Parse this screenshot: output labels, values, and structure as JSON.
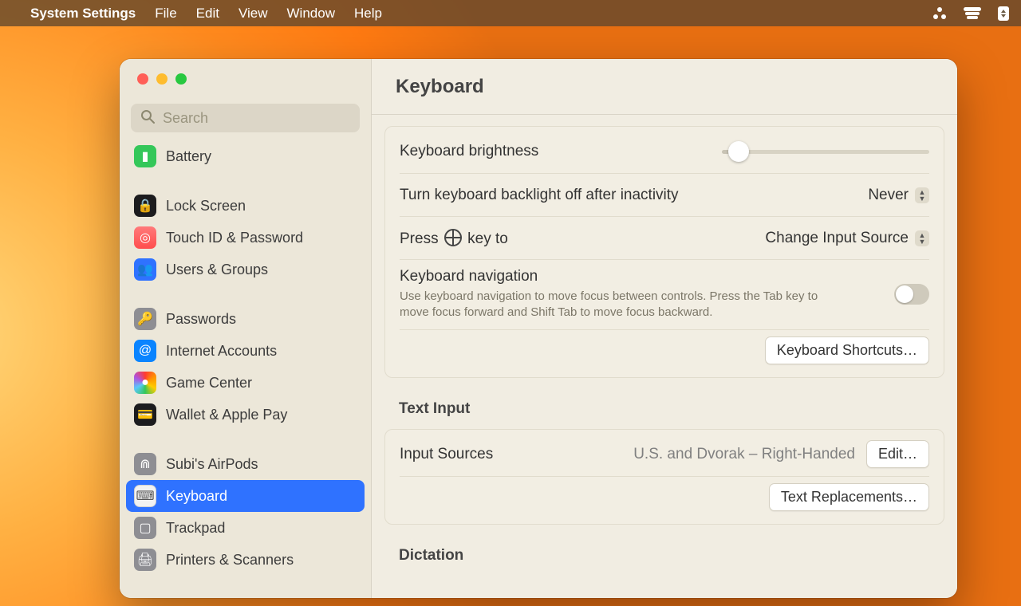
{
  "menubar": {
    "app": "System Settings",
    "items": [
      "File",
      "Edit",
      "View",
      "Window",
      "Help"
    ]
  },
  "search": {
    "placeholder": "Search"
  },
  "sidebar": {
    "items": [
      {
        "label": "Battery",
        "icon": "battery-icon",
        "cls": "bg-green"
      },
      {
        "spacer": true
      },
      {
        "label": "Lock Screen",
        "icon": "lock-icon",
        "cls": "bg-black"
      },
      {
        "label": "Touch ID & Password",
        "icon": "fingerprint-icon",
        "cls": "bg-pinkgr"
      },
      {
        "label": "Users & Groups",
        "icon": "users-icon",
        "cls": "bg-blue"
      },
      {
        "spacer": true
      },
      {
        "label": "Passwords",
        "icon": "key-icon",
        "cls": "bg-grey"
      },
      {
        "label": "Internet Accounts",
        "icon": "at-icon",
        "cls": "bg-blue2"
      },
      {
        "label": "Game Center",
        "icon": "gamecenter-icon",
        "cls": "bg-rainbow"
      },
      {
        "label": "Wallet & Apple Pay",
        "icon": "wallet-icon",
        "cls": "bg-wallet"
      },
      {
        "spacer": true
      },
      {
        "label": "Subi's AirPods",
        "icon": "airpods-icon",
        "cls": "bg-grey"
      },
      {
        "label": "Keyboard",
        "icon": "keyboard-icon",
        "cls": "bg-white",
        "selected": true
      },
      {
        "label": "Trackpad",
        "icon": "trackpad-icon",
        "cls": "bg-grey"
      },
      {
        "label": "Printers & Scanners",
        "icon": "printer-icon",
        "cls": "bg-grey"
      }
    ]
  },
  "page": {
    "title": "Keyboard",
    "brightness_label": "Keyboard brightness",
    "backlight_label": "Turn keyboard backlight off after inactivity",
    "backlight_value": "Never",
    "globe_label_pre": "Press ",
    "globe_label_post": " key to",
    "globe_value": "Change Input Source",
    "nav_label": "Keyboard navigation",
    "nav_desc": "Use keyboard navigation to move focus between controls. Press the Tab key to move focus forward and Shift Tab to move focus backward.",
    "shortcuts_btn": "Keyboard Shortcuts…",
    "text_input_title": "Text Input",
    "input_sources_label": "Input Sources",
    "input_sources_value": "U.S. and Dvorak – Right-Handed",
    "edit_btn": "Edit…",
    "text_repl_btn": "Text Replacements…",
    "dictation_title": "Dictation"
  }
}
